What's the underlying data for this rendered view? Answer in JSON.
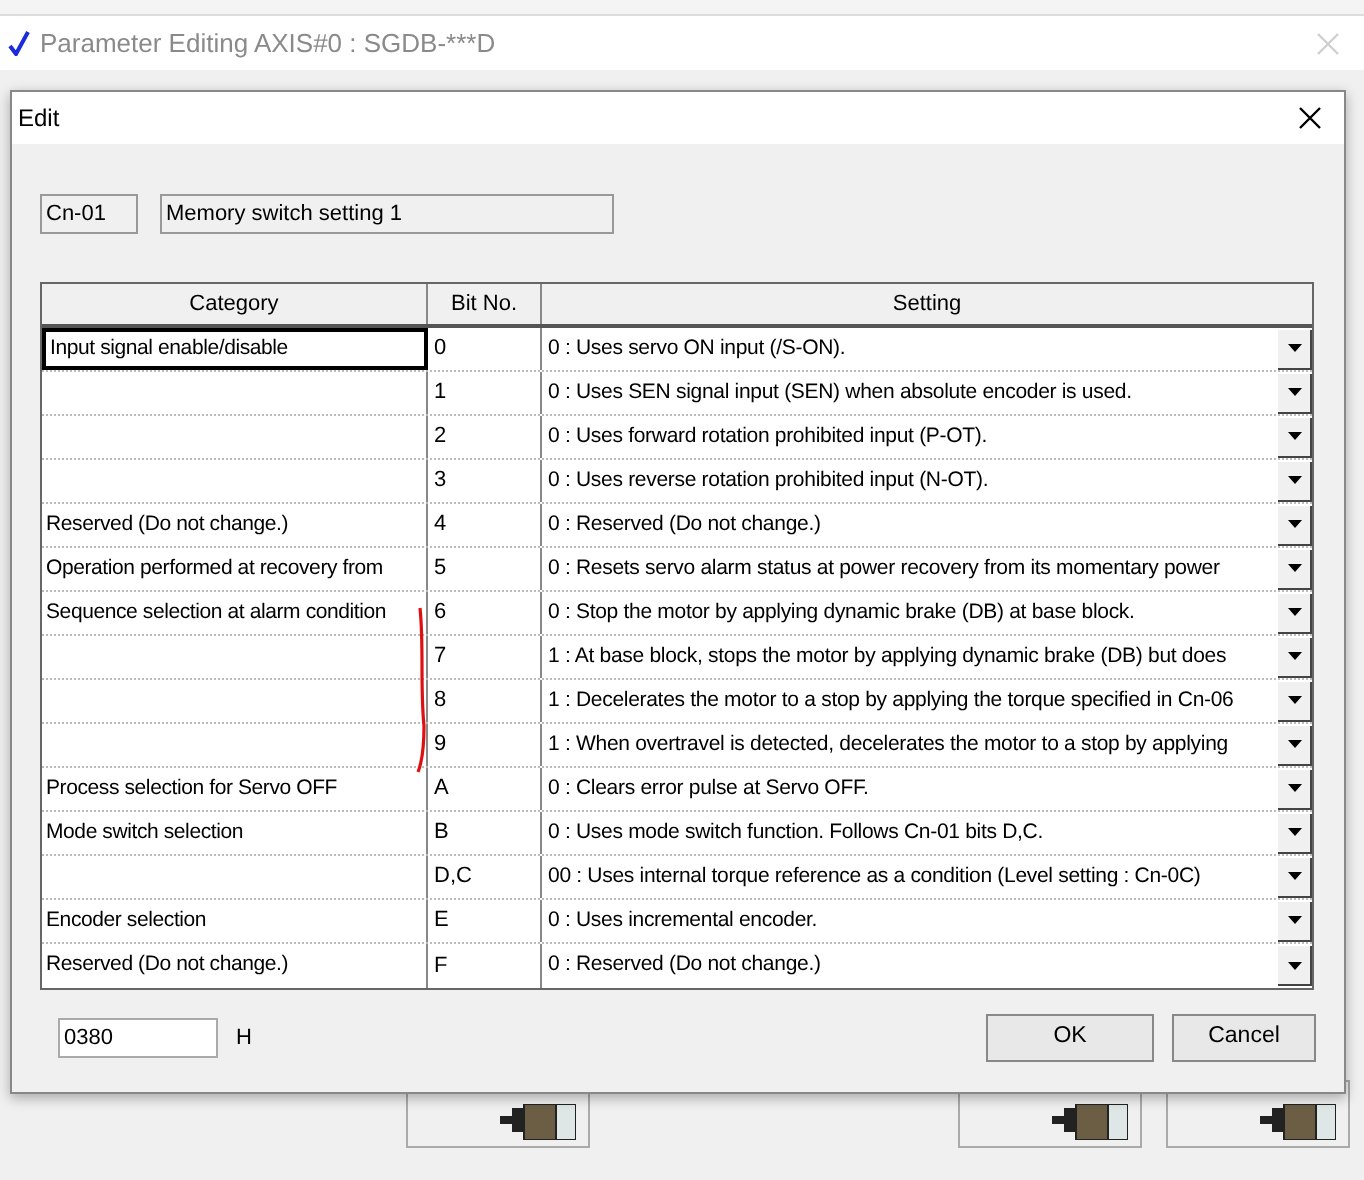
{
  "window": {
    "title": "Parameter Editing AXIS#0 : SGDB-***D"
  },
  "dialog": {
    "title": "Edit",
    "parameter_id": "Cn-01",
    "parameter_name": "Memory switch setting 1",
    "table": {
      "columns": [
        "Category",
        "Bit No.",
        "Setting"
      ],
      "rows": [
        {
          "category": "Input signal enable/disable",
          "bit": "0",
          "setting": "0 : Uses servo ON input (/S-ON).",
          "selected": true
        },
        {
          "category": "",
          "bit": "1",
          "setting": "0 : Uses SEN signal input (SEN) when absolute encoder is used.",
          "selected": false
        },
        {
          "category": "",
          "bit": "2",
          "setting": "0 : Uses forward rotation prohibited input (P-OT).",
          "selected": false
        },
        {
          "category": "",
          "bit": "3",
          "setting": "0 : Uses reverse rotation prohibited input (N-OT).",
          "selected": false
        },
        {
          "category": "Reserved (Do not change.)",
          "bit": "4",
          "setting": "0 : Reserved (Do not change.)",
          "selected": false
        },
        {
          "category": "Operation performed at recovery from",
          "bit": "5",
          "setting": "0 : Resets servo alarm status at power recovery from its momentary power",
          "selected": false
        },
        {
          "category": "Sequence selection at alarm condition",
          "bit": "6",
          "setting": "0 : Stop the motor by applying dynamic brake (DB) at base block.",
          "selected": false
        },
        {
          "category": "",
          "bit": "7",
          "setting": "1 : At base block, stops the motor by applying dynamic brake (DB) but does",
          "selected": false
        },
        {
          "category": "",
          "bit": "8",
          "setting": "1 : Decelerates the motor to a stop by applying the torque specified in Cn-06",
          "selected": false
        },
        {
          "category": "",
          "bit": "9",
          "setting": "1 : When overtravel is detected, decelerates the motor to a stop by applying",
          "selected": false
        },
        {
          "category": "Process selection for Servo OFF",
          "bit": "A",
          "setting": "0 : Clears error pulse at Servo OFF.",
          "selected": false
        },
        {
          "category": "Mode switch selection",
          "bit": "B",
          "setting": "0 : Uses mode switch function. Follows Cn-01 bits D,C.",
          "selected": false
        },
        {
          "category": "",
          "bit": "D,C",
          "setting": "00 : Uses internal torque reference as a condition (Level setting : Cn-0C)",
          "selected": false
        },
        {
          "category": "Encoder selection",
          "bit": "E",
          "setting": "0 : Uses incremental encoder.",
          "selected": false
        },
        {
          "category": "Reserved (Do not change.)",
          "bit": "F",
          "setting": "0 : Reserved (Do not change.)",
          "selected": false
        }
      ]
    },
    "value": "0380",
    "unit": "H",
    "buttons": [
      "OK",
      "Cancel"
    ]
  }
}
